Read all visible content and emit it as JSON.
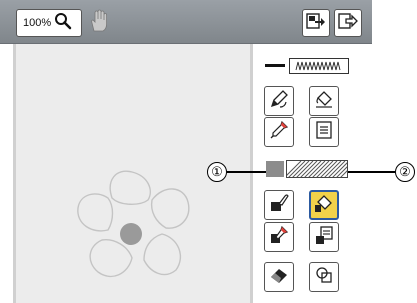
{
  "toolbar": {
    "zoom_label": "100%",
    "icons": [
      "magnifier-icon",
      "hand-icon",
      "import-icon",
      "export-icon"
    ]
  },
  "panel": {
    "tools_top": [
      "line-pen-icon",
      "fill-bucket-icon",
      "line-eyedropper-icon",
      "line-property-icon"
    ],
    "tools_bottom": [
      "brush-icon",
      "area-fill-bucket-icon",
      "fill-eyedropper-icon",
      "fill-property-icon",
      "eraser-icon",
      "select-icon"
    ]
  },
  "callouts": {
    "one": "①",
    "two": "②"
  },
  "colors": {
    "toolbar": "#8a9096",
    "canvas": "#ececec",
    "active_tool": "#f2d24a",
    "active_border": "#2c5aa0",
    "highlight_line": "#1e90ff"
  }
}
